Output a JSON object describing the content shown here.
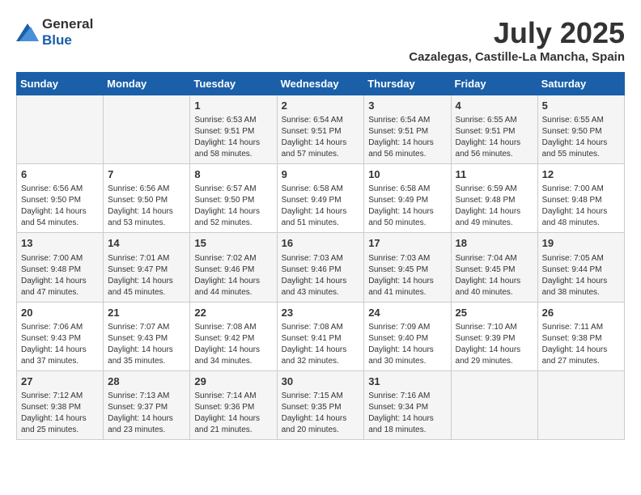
{
  "header": {
    "logo_general": "General",
    "logo_blue": "Blue",
    "title": "July 2025",
    "subtitle": "Cazalegas, Castille-La Mancha, Spain"
  },
  "days_of_week": [
    "Sunday",
    "Monday",
    "Tuesday",
    "Wednesday",
    "Thursday",
    "Friday",
    "Saturday"
  ],
  "weeks": [
    [
      {
        "day": "",
        "info": ""
      },
      {
        "day": "",
        "info": ""
      },
      {
        "day": "1",
        "info": "Sunrise: 6:53 AM\nSunset: 9:51 PM\nDaylight: 14 hours and 58 minutes."
      },
      {
        "day": "2",
        "info": "Sunrise: 6:54 AM\nSunset: 9:51 PM\nDaylight: 14 hours and 57 minutes."
      },
      {
        "day": "3",
        "info": "Sunrise: 6:54 AM\nSunset: 9:51 PM\nDaylight: 14 hours and 56 minutes."
      },
      {
        "day": "4",
        "info": "Sunrise: 6:55 AM\nSunset: 9:51 PM\nDaylight: 14 hours and 56 minutes."
      },
      {
        "day": "5",
        "info": "Sunrise: 6:55 AM\nSunset: 9:50 PM\nDaylight: 14 hours and 55 minutes."
      }
    ],
    [
      {
        "day": "6",
        "info": "Sunrise: 6:56 AM\nSunset: 9:50 PM\nDaylight: 14 hours and 54 minutes."
      },
      {
        "day": "7",
        "info": "Sunrise: 6:56 AM\nSunset: 9:50 PM\nDaylight: 14 hours and 53 minutes."
      },
      {
        "day": "8",
        "info": "Sunrise: 6:57 AM\nSunset: 9:50 PM\nDaylight: 14 hours and 52 minutes."
      },
      {
        "day": "9",
        "info": "Sunrise: 6:58 AM\nSunset: 9:49 PM\nDaylight: 14 hours and 51 minutes."
      },
      {
        "day": "10",
        "info": "Sunrise: 6:58 AM\nSunset: 9:49 PM\nDaylight: 14 hours and 50 minutes."
      },
      {
        "day": "11",
        "info": "Sunrise: 6:59 AM\nSunset: 9:48 PM\nDaylight: 14 hours and 49 minutes."
      },
      {
        "day": "12",
        "info": "Sunrise: 7:00 AM\nSunset: 9:48 PM\nDaylight: 14 hours and 48 minutes."
      }
    ],
    [
      {
        "day": "13",
        "info": "Sunrise: 7:00 AM\nSunset: 9:48 PM\nDaylight: 14 hours and 47 minutes."
      },
      {
        "day": "14",
        "info": "Sunrise: 7:01 AM\nSunset: 9:47 PM\nDaylight: 14 hours and 45 minutes."
      },
      {
        "day": "15",
        "info": "Sunrise: 7:02 AM\nSunset: 9:46 PM\nDaylight: 14 hours and 44 minutes."
      },
      {
        "day": "16",
        "info": "Sunrise: 7:03 AM\nSunset: 9:46 PM\nDaylight: 14 hours and 43 minutes."
      },
      {
        "day": "17",
        "info": "Sunrise: 7:03 AM\nSunset: 9:45 PM\nDaylight: 14 hours and 41 minutes."
      },
      {
        "day": "18",
        "info": "Sunrise: 7:04 AM\nSunset: 9:45 PM\nDaylight: 14 hours and 40 minutes."
      },
      {
        "day": "19",
        "info": "Sunrise: 7:05 AM\nSunset: 9:44 PM\nDaylight: 14 hours and 38 minutes."
      }
    ],
    [
      {
        "day": "20",
        "info": "Sunrise: 7:06 AM\nSunset: 9:43 PM\nDaylight: 14 hours and 37 minutes."
      },
      {
        "day": "21",
        "info": "Sunrise: 7:07 AM\nSunset: 9:43 PM\nDaylight: 14 hours and 35 minutes."
      },
      {
        "day": "22",
        "info": "Sunrise: 7:08 AM\nSunset: 9:42 PM\nDaylight: 14 hours and 34 minutes."
      },
      {
        "day": "23",
        "info": "Sunrise: 7:08 AM\nSunset: 9:41 PM\nDaylight: 14 hours and 32 minutes."
      },
      {
        "day": "24",
        "info": "Sunrise: 7:09 AM\nSunset: 9:40 PM\nDaylight: 14 hours and 30 minutes."
      },
      {
        "day": "25",
        "info": "Sunrise: 7:10 AM\nSunset: 9:39 PM\nDaylight: 14 hours and 29 minutes."
      },
      {
        "day": "26",
        "info": "Sunrise: 7:11 AM\nSunset: 9:38 PM\nDaylight: 14 hours and 27 minutes."
      }
    ],
    [
      {
        "day": "27",
        "info": "Sunrise: 7:12 AM\nSunset: 9:38 PM\nDaylight: 14 hours and 25 minutes."
      },
      {
        "day": "28",
        "info": "Sunrise: 7:13 AM\nSunset: 9:37 PM\nDaylight: 14 hours and 23 minutes."
      },
      {
        "day": "29",
        "info": "Sunrise: 7:14 AM\nSunset: 9:36 PM\nDaylight: 14 hours and 21 minutes."
      },
      {
        "day": "30",
        "info": "Sunrise: 7:15 AM\nSunset: 9:35 PM\nDaylight: 14 hours and 20 minutes."
      },
      {
        "day": "31",
        "info": "Sunrise: 7:16 AM\nSunset: 9:34 PM\nDaylight: 14 hours and 18 minutes."
      },
      {
        "day": "",
        "info": ""
      },
      {
        "day": "",
        "info": ""
      }
    ]
  ]
}
